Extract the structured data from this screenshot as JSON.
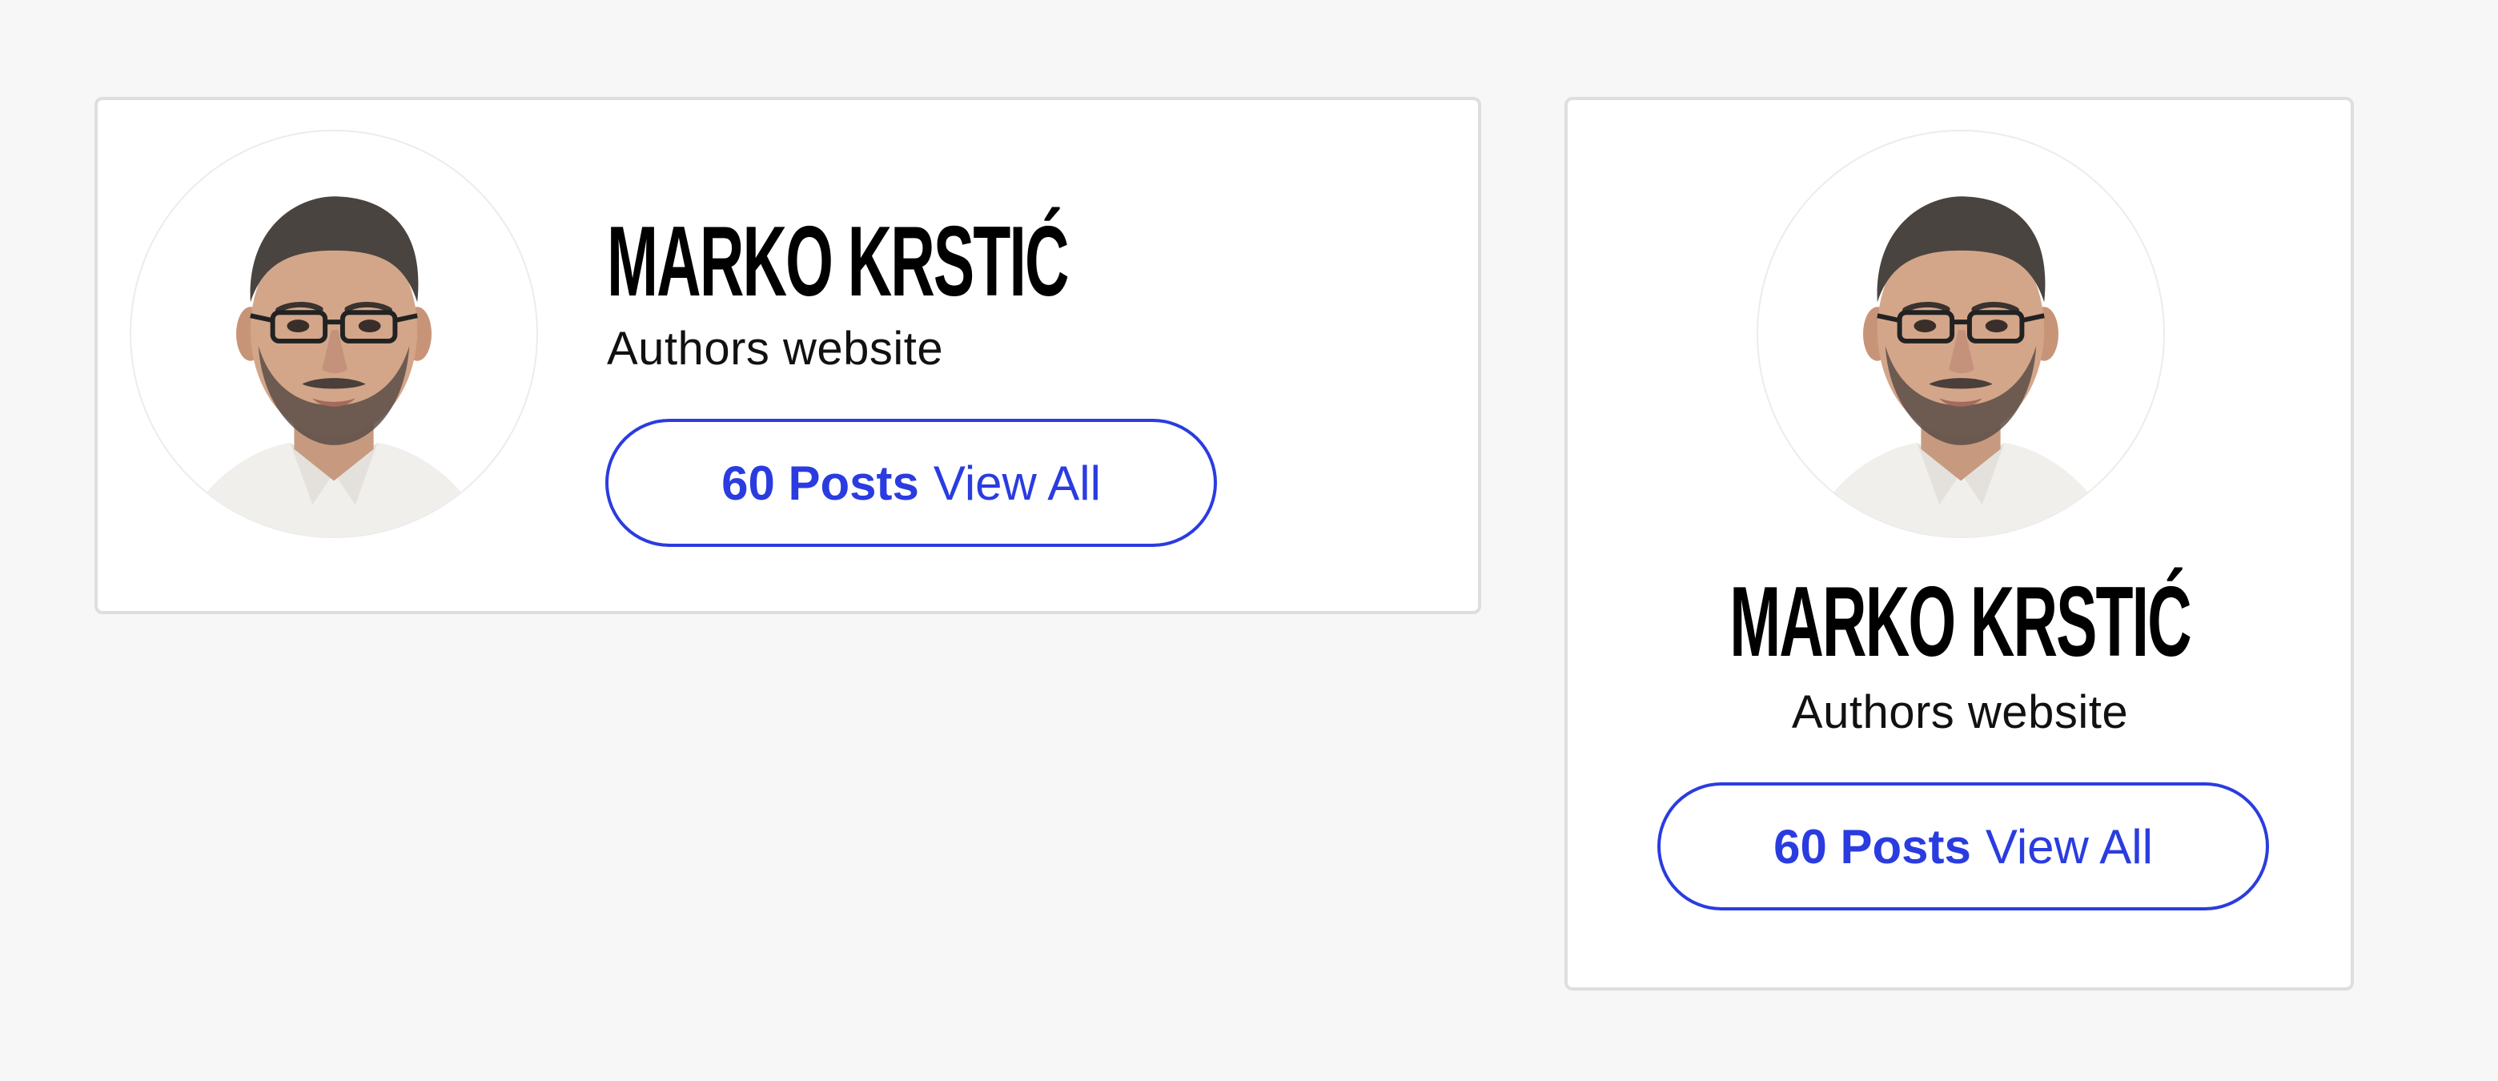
{
  "cards": [
    {
      "layout": "horizontal",
      "author_name": "MARKO KRSTIĆ",
      "author_link": "Authors website",
      "posts_count": "60 Posts",
      "view_all": "View All"
    },
    {
      "layout": "vertical",
      "author_name": "MARKO KRSTIĆ",
      "author_link": "Authors website",
      "posts_count": "60 Posts",
      "view_all": "View All"
    }
  ],
  "colors": {
    "accent": "#2a3ce0",
    "page_background": "#f7f7f7",
    "card_background": "#ffffff",
    "card_border": "#dedede"
  },
  "icons": {
    "avatar": "author-photo"
  }
}
